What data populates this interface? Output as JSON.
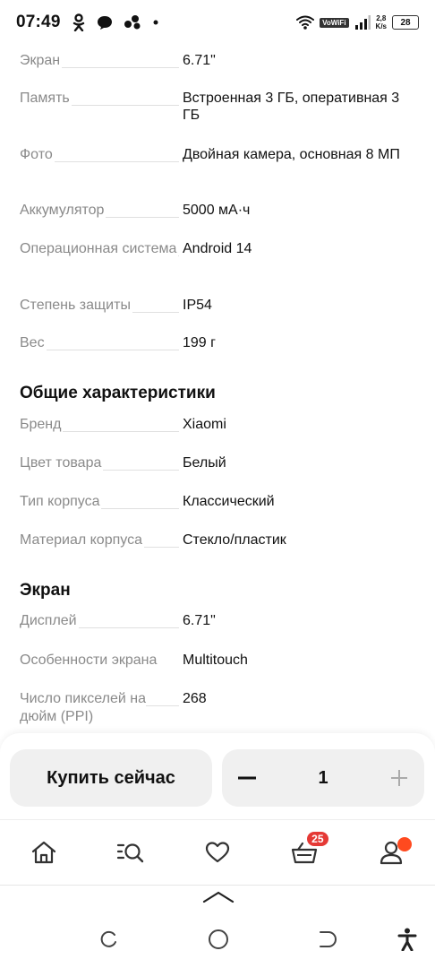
{
  "status_bar": {
    "time": "07:49",
    "speed_value": "2,8",
    "speed_unit": "K/s",
    "battery": "28",
    "volte": "VoWiFi"
  },
  "specs": {
    "top_rows": [
      {
        "key": "Экран",
        "value": "6.71\""
      },
      {
        "key": "Память",
        "value": "Встроенная 3 ГБ, оперативная 3 ГБ"
      },
      {
        "key": "Фото",
        "value": "Двойная камера, основная 8 МП"
      },
      {
        "key": "Аккумулятор",
        "value": "5000 мА·ч"
      },
      {
        "key": "Операционная система",
        "value": "Android 14"
      },
      {
        "key": "Степень защиты",
        "value": "IP54"
      },
      {
        "key": "Вес",
        "value": "199 г"
      }
    ],
    "general_title": "Общие характеристики",
    "general_rows": [
      {
        "key": "Бренд",
        "value": "Xiaomi"
      },
      {
        "key": "Цвет товара",
        "value": "Белый"
      },
      {
        "key": "Тип корпуса",
        "value": "Классический"
      },
      {
        "key": "Материал корпуса",
        "value": "Стекло/пластик"
      }
    ],
    "screen_title": "Экран",
    "screen_rows": [
      {
        "key": "Дисплей",
        "value": "6.71\""
      },
      {
        "key": "Особенности экрана",
        "value": "Multitouch"
      },
      {
        "key": "Число пикселей на дюйм (PPI)",
        "value": "268"
      }
    ]
  },
  "buy_panel": {
    "buy_label": "Купить сейчас",
    "quantity": "1"
  },
  "nav": {
    "cart_badge": "25"
  },
  "colors": {
    "badge": "#e53935",
    "profile_dot": "#ff4a1f",
    "button_bg": "#f0f0f0"
  }
}
